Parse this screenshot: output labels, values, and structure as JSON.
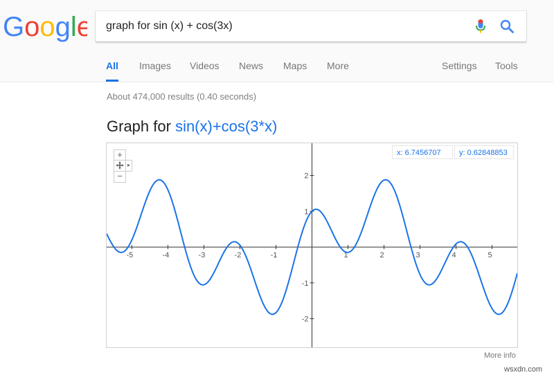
{
  "search": {
    "query": "graph for sin (x) + cos(3x)"
  },
  "logo": {
    "text": "Google"
  },
  "tabs": [
    {
      "label": "All"
    },
    {
      "label": "Images"
    },
    {
      "label": "Videos"
    },
    {
      "label": "News"
    },
    {
      "label": "Maps"
    },
    {
      "label": "More"
    },
    {
      "label": "Settings"
    },
    {
      "label": "Tools"
    }
  ],
  "results": {
    "stats": "About 474,000 results (0.40 seconds)"
  },
  "graph": {
    "title_prefix": "Graph for",
    "function": "sin(x)+cos(3*x)",
    "coord_x": "x: 6.7456707",
    "coord_y": "y: 0.62848853",
    "more_info": "More info",
    "controls": {
      "zoom_in": "+",
      "zoom_out": "−"
    }
  },
  "watermark": "wsxdn.com",
  "icons": {
    "mic": "mic-icon",
    "search": "search-icon",
    "pan": "pan-icon"
  },
  "colors": {
    "accent": "#1a73e8",
    "curve": "#1a73e8",
    "axis": "#333333"
  },
  "chart_data": {
    "type": "line",
    "function": "sin(x)+cos(3*x)",
    "xlim": [
      -5.7,
      5.7
    ],
    "ylim": [
      -2.8,
      2.9
    ],
    "xticks": [
      -5,
      -4,
      -3,
      -2,
      -1,
      1,
      2,
      3,
      4,
      5
    ],
    "yticks": [
      -2,
      -1,
      1,
      2
    ],
    "grid": false
  }
}
